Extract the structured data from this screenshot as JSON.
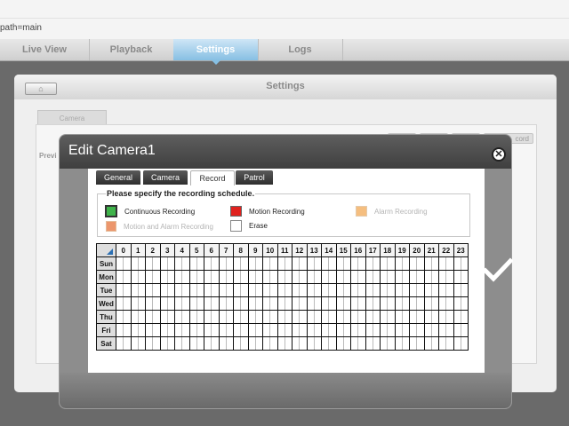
{
  "address_bar": {
    "url_fragment": "path=main"
  },
  "nav": {
    "tabs": [
      {
        "label": "Live View",
        "active": false
      },
      {
        "label": "Playback",
        "active": false
      },
      {
        "label": "Settings",
        "active": true
      },
      {
        "label": "Logs",
        "active": false
      }
    ]
  },
  "settings_panel": {
    "title": "Settings",
    "camera_tab": "Camera",
    "list_header_partial": "Previ",
    "record_button_partial": "cord"
  },
  "modal": {
    "title": "Edit Camera1",
    "tabs": [
      {
        "label": "General",
        "active": false
      },
      {
        "label": "Camera",
        "active": false
      },
      {
        "label": "Record",
        "active": true
      },
      {
        "label": "Patrol",
        "active": false
      }
    ],
    "schedule_prompt": "Please specify the recording schedule.",
    "legend": [
      {
        "label": "Continuous Recording",
        "color": "#3fb34a",
        "enabled": true
      },
      {
        "label": "Motion Recording",
        "color": "#e0221f",
        "enabled": true
      },
      {
        "label": "Alarm Recording",
        "color": "#f2a349",
        "enabled": false
      },
      {
        "label": "Motion and Alarm Recording",
        "color": "#e46a2e",
        "enabled": false
      },
      {
        "label": "Erase",
        "color": "#ffffff",
        "enabled": true
      }
    ],
    "hours": [
      "0",
      "1",
      "2",
      "3",
      "4",
      "5",
      "6",
      "7",
      "8",
      "9",
      "10",
      "11",
      "12",
      "13",
      "14",
      "15",
      "16",
      "17",
      "18",
      "19",
      "20",
      "21",
      "22",
      "23"
    ],
    "days": [
      "Sun",
      "Mon",
      "Tue",
      "Wed",
      "Thu",
      "Fri",
      "Sat"
    ]
  }
}
